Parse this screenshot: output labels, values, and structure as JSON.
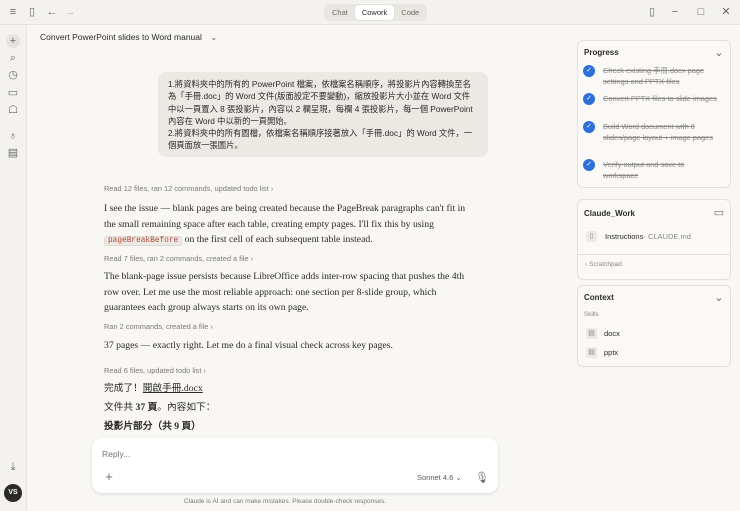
{
  "topbar": {
    "tabs": [
      {
        "label": "Chat"
      },
      {
        "label": "Cowork",
        "active": true
      },
      {
        "label": "Code"
      }
    ]
  },
  "rail": {
    "avatar": "VS"
  },
  "main": {
    "title": "Convert PowerPoint slides to Word manual",
    "user_message": [
      "1.將資料夾中的所有的 PowerPoint 檔案，依檔案名稱順序，將投影片內容轉換至名為「手冊.doc」的 Word 文件(版面設定不要變動)，縮放投影片大小並在 Word 文件中以一頁置入 8 張投影片，內容以 2 欄呈現，每欄 4 張投影片，每一個 PowerPoint 內容在 Word 中以新的一頁開始。",
      "2.將資料夾中的所有圖檔，依檔案名稱順序接著放入「手冊.doc」的 Word 文件，一個頁面放一張圖片。"
    ],
    "steps": [
      {
        "meta": "Read 12 files, ran 12 commands, updated todo list",
        "text_a": "I see the issue — blank pages are being created because the PageBreak paragraphs can't fit in the small remaining space after each table, creating empty pages. I'll fix this by using ",
        "code": "pageBreakBefore",
        "text_b": " on the first cell of each subsequent table instead."
      },
      {
        "meta": "Read 7 files, ran 2 commands, created a file",
        "text": "The blank-page issue persists because LibreOffice adds inter-row spacing that pushes the 4th row over. Let me use the most reliable approach: one section per 8-slide group, which guarantees each group always starts on its own page."
      },
      {
        "meta": "Ran 2 commands, created a file",
        "text": "37 pages — exactly right. Let me do a final visual check across key pages."
      },
      {
        "meta": "Read 6 files, updated todo list"
      }
    ],
    "done_prefix": "完成了！",
    "done_link": "開啟手冊.docx",
    "pages_a": "文件共 ",
    "pages_b": "37 頁",
    "pages_c": "。內容如下：",
    "section": "投影片部分（共 9 頁）",
    "input": {
      "placeholder": "Reply...",
      "model": "Sonnet 4.6"
    },
    "footer": "Claude is AI and can make mistakes. Please double-check responses."
  },
  "progress": {
    "title": "Progress",
    "items": [
      "Check existing 手冊.docx page settings and PPTX files",
      "Convert PPTX files to slide images",
      "Build Word document with 8 slides/page layout + image pages",
      "Verify output and save to workspace"
    ]
  },
  "workspace": {
    "title": "Claude_Work",
    "file_name": "Instructions",
    "file_sub": " · CLAUDE.md",
    "scratchpad": "Scratchpad"
  },
  "context": {
    "title": "Context",
    "skills_label": "Skills",
    "skills": [
      "docx",
      "pptx"
    ]
  },
  "colors": {
    "accent": "#2e6fd8",
    "background": "#f8f7f4"
  }
}
